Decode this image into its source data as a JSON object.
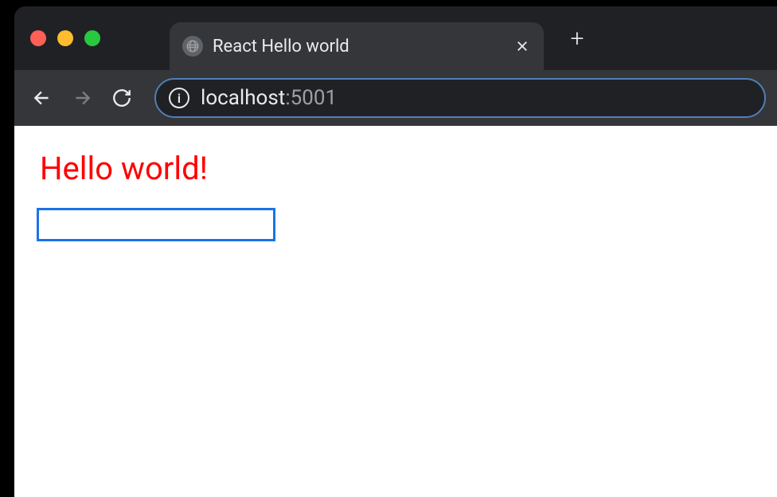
{
  "tab": {
    "title": "React Hello world"
  },
  "address": {
    "host": "localhost",
    "port": ":5001"
  },
  "page": {
    "heading": "Hello world!",
    "input_value": ""
  }
}
